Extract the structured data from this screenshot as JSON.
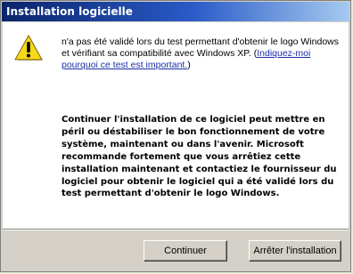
{
  "window": {
    "title": "Installation logicielle"
  },
  "message": {
    "icon": "warning-icon",
    "intro_text": "n'a pas été validé lors du test permettant d'obtenir le logo Windows et vérifiant sa compatibilité avec Windows XP. (",
    "intro_link": "Indiquez-moi pourquoi ce test est important.",
    "intro_end": ")",
    "warning_text": "Continuer l'installation de ce logiciel peut mettre en péril ou déstabiliser le bon fonctionnement de votre système, maintenant ou dans l'avenir. Microsoft recommande fortement que vous arrêtiez cette installation maintenant et contactiez le fournisseur du logiciel pour obtenir le logiciel qui a été validé lors du test permettant d'obtenir le logo Windows."
  },
  "buttons": {
    "continue_label": "Continuer",
    "stop_label": "Arrêter l'installation"
  },
  "colors": {
    "title_bar_start": "#0a246a",
    "title_bar_end": "#a6caf0",
    "link": "#1c2fa8",
    "dialog_face": "#d4d0c8",
    "icon_yellow": "#f7d71c"
  }
}
